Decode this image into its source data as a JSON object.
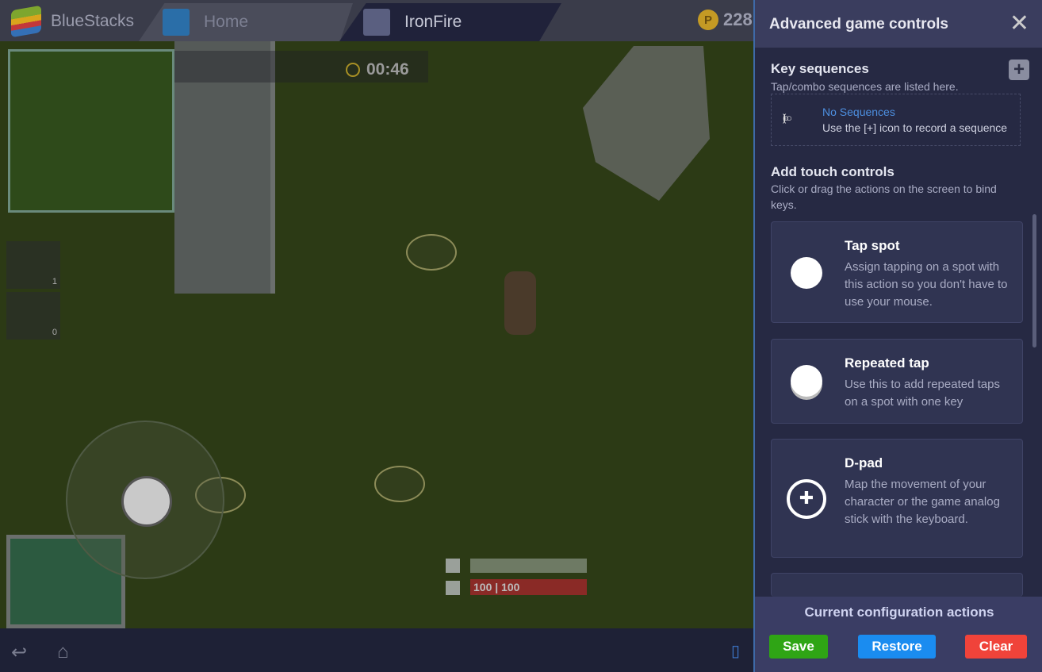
{
  "header": {
    "app": "BlueStacks",
    "tabs": [
      {
        "label": "Home"
      },
      {
        "label": "IronFire"
      }
    ],
    "coins": "228"
  },
  "game": {
    "timer": "00:46",
    "health": "100 | 100",
    "inventory": [
      {
        "count": "1"
      },
      {
        "count": "0"
      }
    ]
  },
  "panel": {
    "title": "Advanced game controls",
    "key_sequences": {
      "title": "Key sequences",
      "subtitle": "Tap/combo sequences are listed here.",
      "empty_title": "No Sequences",
      "empty_desc": "Use the [+] icon to record a sequence"
    },
    "touch": {
      "title": "Add touch controls",
      "subtitle": "Click or drag the actions on the screen to bind keys."
    },
    "controls": [
      {
        "title": "Tap spot",
        "desc": "Assign tapping on a spot with this action so you don't have to use your mouse.",
        "icon": "circle-icon"
      },
      {
        "title": "Repeated tap",
        "desc": "Use this to add repeated taps on a spot with one key",
        "icon": "stacked-circle-icon"
      },
      {
        "title": "D-pad",
        "desc": "Map the movement of your character or the game analog stick with the keyboard.",
        "icon": "dpad-icon"
      }
    ],
    "footer": {
      "title": "Current configuration actions",
      "save": "Save",
      "restore": "Restore",
      "clear": "Clear"
    },
    "colors": {
      "save": "#2fa515",
      "restore": "#1a8cf0",
      "clear": "#f0433a",
      "link": "#4d8fe0"
    }
  }
}
